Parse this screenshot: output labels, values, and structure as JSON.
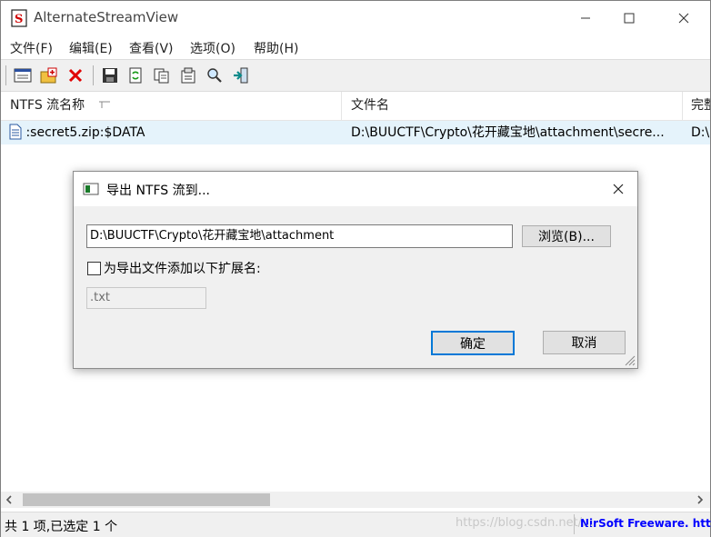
{
  "window": {
    "title": "AlternateStreamView"
  },
  "menu": [
    "文件(F)",
    "编辑(E)",
    "查看(V)",
    "选项(O)",
    "帮助(H)"
  ],
  "columns": [
    "NTFS 流名称",
    "文件名",
    "完整"
  ],
  "rows": [
    {
      "stream": ":secret5.zip:$DATA",
      "filename": "D:\\BUUCTF\\Crypto\\花开藏宝地\\attachment\\secre...",
      "fullpath": "D:\\"
    }
  ],
  "dialog": {
    "title": "导出 NTFS 流到...",
    "path_value": "D:\\BUUCTF\\Crypto\\花开藏宝地\\attachment",
    "browse_label": "浏览(B)...",
    "checkbox_label": "为导出文件添加以下扩展名:",
    "checkbox_checked": false,
    "ext_value": ".txt",
    "ok_label": "确定",
    "cancel_label": "取消"
  },
  "status": {
    "count_text": "共 1 项,已选定 1 个",
    "brand_text": "NirSoft Freeware. htt",
    "watermark": "https://blog.csdn.net/..."
  },
  "colors": {
    "accent": "#0078d7",
    "brand": "#0000ff",
    "selection": "#e5f3fb"
  }
}
